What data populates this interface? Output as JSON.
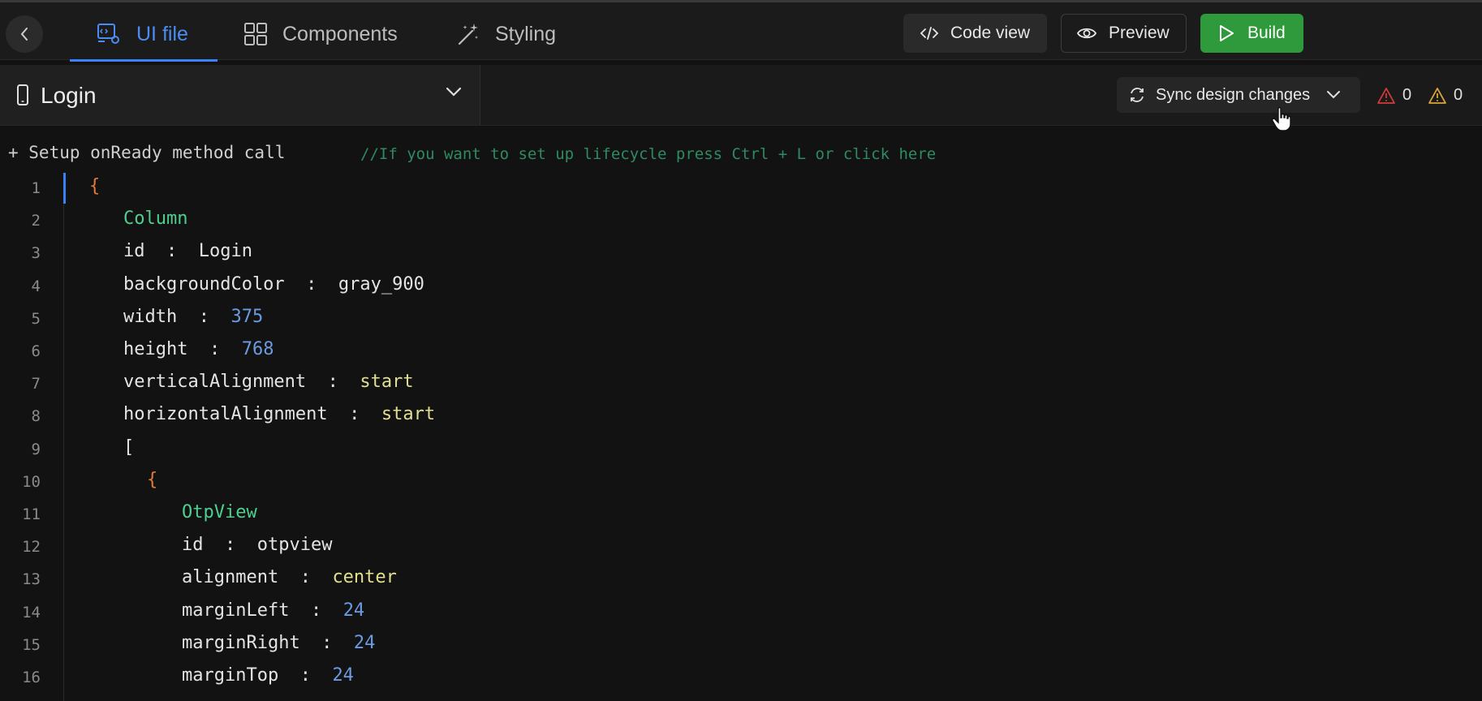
{
  "header": {
    "tabs": [
      {
        "label": "UI file",
        "icon": "ui-file-icon",
        "active": true
      },
      {
        "label": "Components",
        "icon": "components-grid-icon",
        "active": false
      },
      {
        "label": "Styling",
        "icon": "magic-wand-icon",
        "active": false
      }
    ],
    "buttons": {
      "code_view": "Code view",
      "preview": "Preview",
      "build": "Build"
    },
    "colors": {
      "accent": "#3b82f6",
      "build": "#2f9a3b"
    }
  },
  "subbar": {
    "screen_name": "Login",
    "sync_label": "Sync design changes",
    "error_count": "0",
    "warning_count": "0"
  },
  "hint": {
    "action": "+ Setup onReady method call",
    "comment": "//If you want to set up lifecycle press Ctrl + L or click here"
  },
  "code": [
    {
      "n": "1",
      "tokens": [
        {
          "t": "{",
          "c": "brace"
        }
      ]
    },
    {
      "n": "2",
      "tokens": [
        {
          "t": "Column",
          "c": "comp"
        }
      ]
    },
    {
      "n": "3",
      "tokens": [
        {
          "t": "id  :  ",
          "c": "key"
        },
        {
          "t": "Login",
          "c": "key"
        }
      ]
    },
    {
      "n": "4",
      "tokens": [
        {
          "t": "backgroundColor  :  ",
          "c": "key"
        },
        {
          "t": "gray_900",
          "c": "key"
        }
      ]
    },
    {
      "n": "5",
      "tokens": [
        {
          "t": "width  :  ",
          "c": "key"
        },
        {
          "t": "375",
          "c": "num"
        }
      ]
    },
    {
      "n": "6",
      "tokens": [
        {
          "t": "height  :  ",
          "c": "key"
        },
        {
          "t": "768",
          "c": "num"
        }
      ]
    },
    {
      "n": "7",
      "tokens": [
        {
          "t": "verticalAlignment  :  ",
          "c": "key"
        },
        {
          "t": "start",
          "c": "enum"
        }
      ]
    },
    {
      "n": "8",
      "tokens": [
        {
          "t": "horizontalAlignment  :  ",
          "c": "key"
        },
        {
          "t": "start",
          "c": "enum"
        }
      ]
    },
    {
      "n": "9",
      "tokens": [
        {
          "t": "[",
          "c": "key"
        }
      ]
    },
    {
      "n": "10",
      "tokens": [
        {
          "t": "{",
          "c": "brace"
        }
      ]
    },
    {
      "n": "11",
      "tokens": [
        {
          "t": "OtpView",
          "c": "comp"
        }
      ]
    },
    {
      "n": "12",
      "tokens": [
        {
          "t": "id  :  ",
          "c": "key"
        },
        {
          "t": "otpview",
          "c": "key"
        }
      ]
    },
    {
      "n": "13",
      "tokens": [
        {
          "t": "alignment  :  ",
          "c": "key"
        },
        {
          "t": "center",
          "c": "enum"
        }
      ]
    },
    {
      "n": "14",
      "tokens": [
        {
          "t": "marginLeft  :  ",
          "c": "key"
        },
        {
          "t": "24",
          "c": "num"
        }
      ]
    },
    {
      "n": "15",
      "tokens": [
        {
          "t": "marginRight  :  ",
          "c": "key"
        },
        {
          "t": "24",
          "c": "num"
        }
      ]
    },
    {
      "n": "16",
      "tokens": [
        {
          "t": "marginTop  :  ",
          "c": "key"
        },
        {
          "t": "24",
          "c": "num"
        }
      ]
    }
  ]
}
